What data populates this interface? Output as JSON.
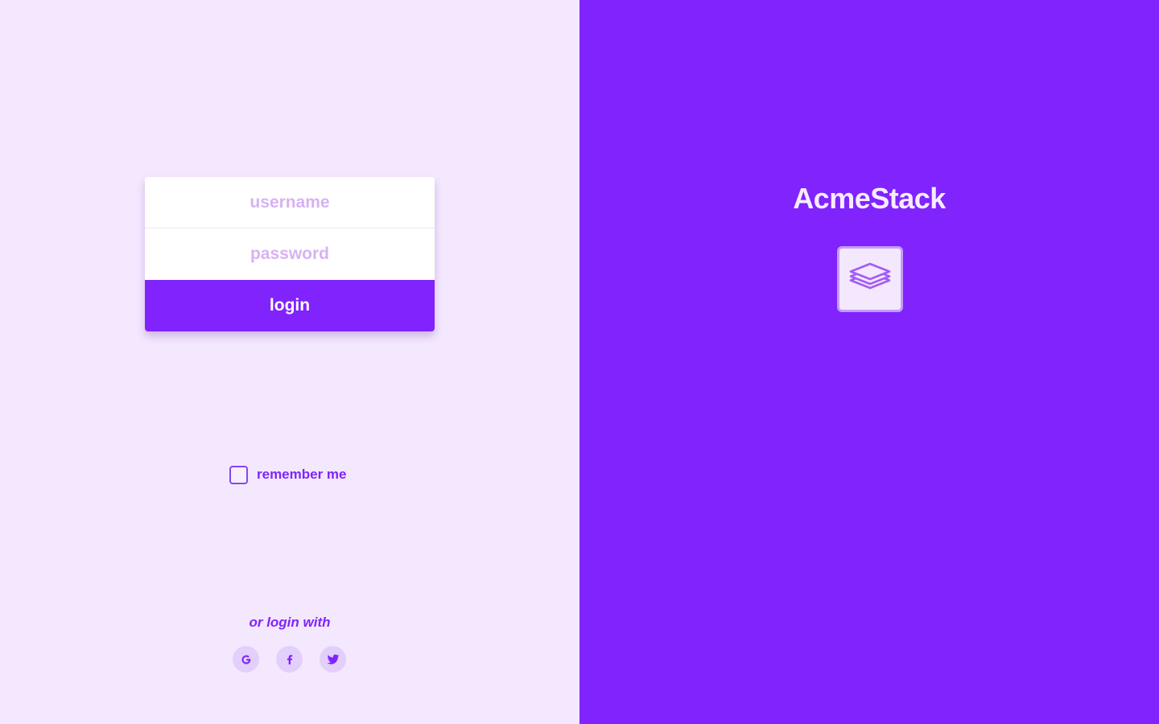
{
  "login_form": {
    "username_placeholder": "username",
    "password_placeholder": "password",
    "login_label": "login"
  },
  "remember": {
    "label": "remember me",
    "checked": false
  },
  "social": {
    "prompt": "or login with",
    "providers": [
      {
        "name": "google",
        "icon": "google-icon"
      },
      {
        "name": "facebook",
        "icon": "facebook-icon"
      },
      {
        "name": "twitter",
        "icon": "twitter-icon"
      }
    ]
  },
  "brand": {
    "title": "AcmeStack",
    "logo_icon": "layers-icon"
  },
  "colors": {
    "primary": "#8023fd",
    "left_background": "#f3e8fe",
    "placeholder": "#d7b2f3",
    "social_bg": "#e3cffb"
  }
}
